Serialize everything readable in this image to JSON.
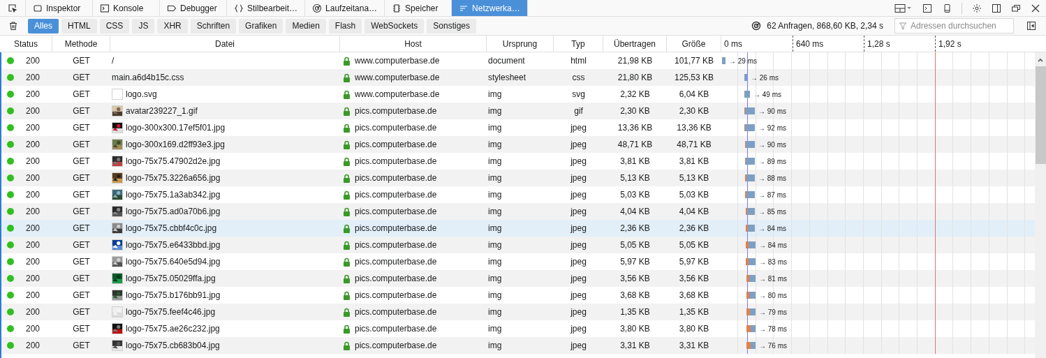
{
  "toolbar": {
    "tabs": [
      {
        "label": "Inspektor",
        "selected": false
      },
      {
        "label": "Konsole",
        "selected": false
      },
      {
        "label": "Debugger",
        "selected": false
      },
      {
        "label": "Stilbearbeit…",
        "selected": false
      },
      {
        "label": "Laufzeitana…",
        "selected": false
      },
      {
        "label": "Speicher",
        "selected": false
      },
      {
        "label": "Netzwerka…",
        "selected": true
      }
    ]
  },
  "filters": [
    {
      "label": "Alles",
      "selected": true
    },
    {
      "label": "HTML",
      "selected": false
    },
    {
      "label": "CSS",
      "selected": false
    },
    {
      "label": "JS",
      "selected": false
    },
    {
      "label": "XHR",
      "selected": false
    },
    {
      "label": "Schriften",
      "selected": false
    },
    {
      "label": "Grafiken",
      "selected": false
    },
    {
      "label": "Medien",
      "selected": false
    },
    {
      "label": "Flash",
      "selected": false
    },
    {
      "label": "WebSockets",
      "selected": false
    },
    {
      "label": "Sonstiges",
      "selected": false
    }
  ],
  "summary": "62 Anfragen, 868,60 KB, 2,34 s",
  "search": {
    "placeholder": "Adressen durchsuchen"
  },
  "table": {
    "columns": [
      "Status",
      "Methode",
      "Datei",
      "Host",
      "Ursprung",
      "Typ",
      "Übertragen",
      "Größe"
    ],
    "timeline_ticks": [
      "0 ms",
      "640 ms",
      "1,28 s",
      "1,92 s"
    ],
    "rows": [
      {
        "status": "200",
        "method": "GET",
        "file": "/",
        "thumbnail": false,
        "host": "www.computerbase.de",
        "origin": "document",
        "type": "html",
        "transferred": "21,98 KB",
        "size": "101,77 KB",
        "time": "→ 29 ms",
        "selected": false
      },
      {
        "status": "200",
        "method": "GET",
        "file": "main.a6d4b15c.css",
        "thumbnail": false,
        "host": "www.computerbase.de",
        "origin": "stylesheet",
        "type": "css",
        "transferred": "21,80 KB",
        "size": "125,53 KB",
        "time": "→ 26 ms",
        "selected": false
      },
      {
        "status": "200",
        "method": "GET",
        "file": "logo.svg",
        "thumbnail": true,
        "host": "www.computerbase.de",
        "origin": "img",
        "type": "svg",
        "transferred": "2,32 KB",
        "size": "6,04 KB",
        "time": "→ 49 ms",
        "selected": false
      },
      {
        "status": "200",
        "method": "GET",
        "file": "avatar239227_1.gif",
        "thumbnail": true,
        "host": "pics.computerbase.de",
        "origin": "img",
        "type": "gif",
        "transferred": "2,30 KB",
        "size": "2,30 KB",
        "time": "→ 90 ms",
        "selected": false
      },
      {
        "status": "200",
        "method": "GET",
        "file": "logo-300x300.17ef5f01.jpg",
        "thumbnail": true,
        "host": "pics.computerbase.de",
        "origin": "img",
        "type": "jpeg",
        "transferred": "13,36 KB",
        "size": "13,36 KB",
        "time": "→ 92 ms",
        "selected": false
      },
      {
        "status": "200",
        "method": "GET",
        "file": "logo-300x169.d2ff93e3.jpg",
        "thumbnail": true,
        "host": "pics.computerbase.de",
        "origin": "img",
        "type": "jpeg",
        "transferred": "48,71 KB",
        "size": "48,71 KB",
        "time": "→ 90 ms",
        "selected": false
      },
      {
        "status": "200",
        "method": "GET",
        "file": "logo-75x75.47902d2e.jpg",
        "thumbnail": true,
        "host": "pics.computerbase.de",
        "origin": "img",
        "type": "jpeg",
        "transferred": "3,81 KB",
        "size": "3,81 KB",
        "time": "→ 89 ms",
        "selected": false
      },
      {
        "status": "200",
        "method": "GET",
        "file": "logo-75x75.3226a656.jpg",
        "thumbnail": true,
        "host": "pics.computerbase.de",
        "origin": "img",
        "type": "jpeg",
        "transferred": "5,13 KB",
        "size": "5,13 KB",
        "time": "→ 88 ms",
        "selected": false
      },
      {
        "status": "200",
        "method": "GET",
        "file": "logo-75x75.1a3ab342.jpg",
        "thumbnail": true,
        "host": "pics.computerbase.de",
        "origin": "img",
        "type": "jpeg",
        "transferred": "5,03 KB",
        "size": "5,03 KB",
        "time": "→ 87 ms",
        "selected": false
      },
      {
        "status": "200",
        "method": "GET",
        "file": "logo-75x75.ad0a70b6.jpg",
        "thumbnail": true,
        "host": "pics.computerbase.de",
        "origin": "img",
        "type": "jpeg",
        "transferred": "4,04 KB",
        "size": "4,04 KB",
        "time": "→ 85 ms",
        "selected": false
      },
      {
        "status": "200",
        "method": "GET",
        "file": "logo-75x75.cbbf4c0c.jpg",
        "thumbnail": true,
        "host": "pics.computerbase.de",
        "origin": "img",
        "type": "jpeg",
        "transferred": "2,36 KB",
        "size": "2,36 KB",
        "time": "→ 84 ms",
        "selected": true
      },
      {
        "status": "200",
        "method": "GET",
        "file": "logo-75x75.e6433bbd.jpg",
        "thumbnail": true,
        "host": "pics.computerbase.de",
        "origin": "img",
        "type": "jpeg",
        "transferred": "5,05 KB",
        "size": "5,05 KB",
        "time": "→ 84 ms",
        "selected": false
      },
      {
        "status": "200",
        "method": "GET",
        "file": "logo-75x75.640e5d94.jpg",
        "thumbnail": true,
        "host": "pics.computerbase.de",
        "origin": "img",
        "type": "jpeg",
        "transferred": "5,97 KB",
        "size": "5,97 KB",
        "time": "→ 83 ms",
        "selected": false
      },
      {
        "status": "200",
        "method": "GET",
        "file": "logo-75x75.05029ffa.jpg",
        "thumbnail": true,
        "host": "pics.computerbase.de",
        "origin": "img",
        "type": "jpeg",
        "transferred": "3,56 KB",
        "size": "3,56 KB",
        "time": "→ 81 ms",
        "selected": false
      },
      {
        "status": "200",
        "method": "GET",
        "file": "logo-75x75.b176bb91.jpg",
        "thumbnail": true,
        "host": "pics.computerbase.de",
        "origin": "img",
        "type": "jpeg",
        "transferred": "3,68 KB",
        "size": "3,68 KB",
        "time": "→ 80 ms",
        "selected": false
      },
      {
        "status": "200",
        "method": "GET",
        "file": "logo-75x75.feef4c46.jpg",
        "thumbnail": true,
        "host": "pics.computerbase.de",
        "origin": "img",
        "type": "jpeg",
        "transferred": "1,35 KB",
        "size": "1,35 KB",
        "time": "→ 79 ms",
        "selected": false
      },
      {
        "status": "200",
        "method": "GET",
        "file": "logo-75x75.ae26c232.jpg",
        "thumbnail": true,
        "host": "pics.computerbase.de",
        "origin": "img",
        "type": "jpeg",
        "transferred": "3,80 KB",
        "size": "3,80 KB",
        "time": "→ 78 ms",
        "selected": false
      },
      {
        "status": "200",
        "method": "GET",
        "file": "logo-75x75.cb683b04.jpg",
        "thumbnail": true,
        "host": "pics.computerbase.de",
        "origin": "img",
        "type": "jpeg",
        "transferred": "3,31 KB",
        "size": "3,31 KB",
        "time": "→ 76 ms",
        "selected": false
      }
    ]
  }
}
